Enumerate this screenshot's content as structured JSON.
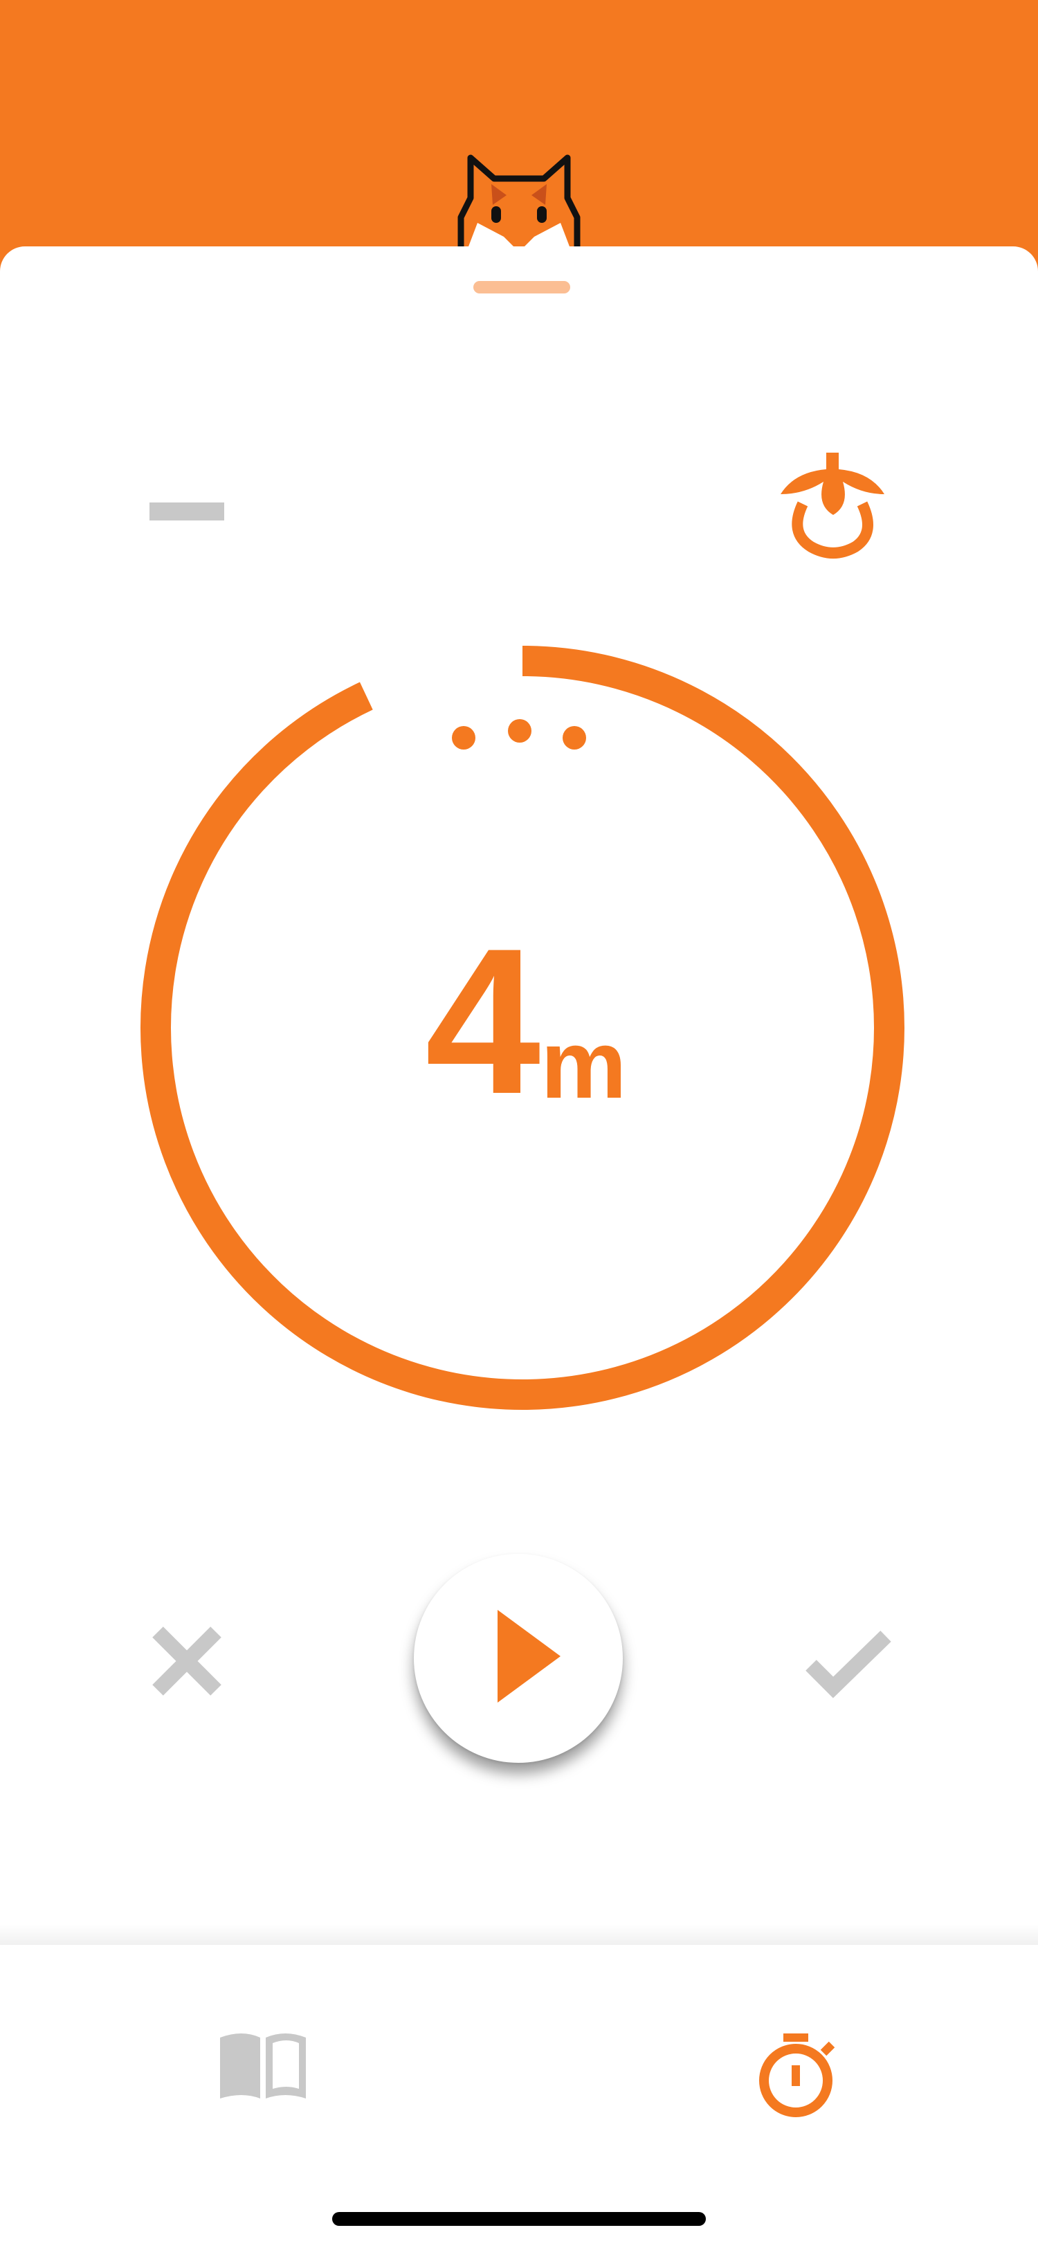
{
  "theme": {
    "accent": "#F47920",
    "accent_light": "#FBBE93",
    "inactive": "#C8C8C8",
    "background": "#FFFFFF"
  },
  "header": {
    "mascot_icon": "fox-icon"
  },
  "controls": {
    "collapse_icon": "minus-icon",
    "pomodoro_icon": "tomato-icon"
  },
  "timer": {
    "value": "4",
    "unit": "m",
    "progress_fraction": 0.93,
    "page_dots": 3
  },
  "actions": {
    "cancel_icon": "close-icon",
    "play_icon": "play-icon",
    "done_icon": "check-icon"
  },
  "tabbar": {
    "tabs": [
      {
        "icon": "book-icon",
        "active": false
      },
      {
        "icon": "stopwatch-icon",
        "active": true
      }
    ]
  }
}
